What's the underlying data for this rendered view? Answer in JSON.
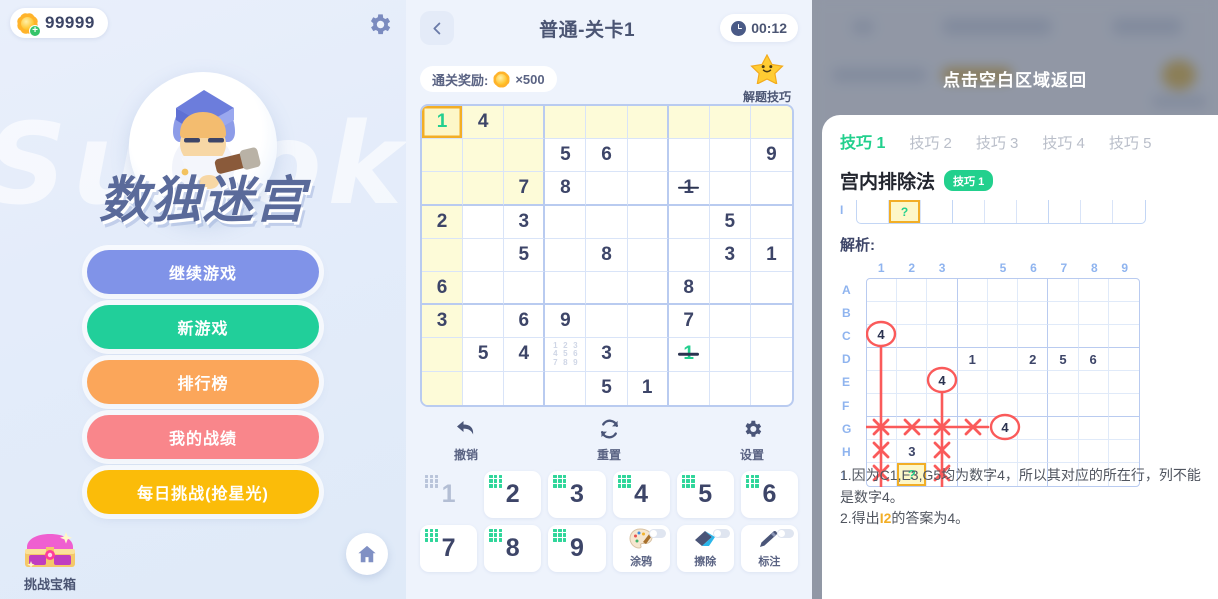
{
  "home": {
    "coin_count": "99999",
    "watermark": "Sudoku",
    "title": "数独迷宫",
    "gear_icon": "gear-icon",
    "coin_icon": "sun-coin-icon",
    "buttons": [
      {
        "label": "继续游戏",
        "color": "#8093e8"
      },
      {
        "label": "新游戏",
        "color": "#21cf9a"
      },
      {
        "label": "排行榜",
        "color": "#fba65a"
      },
      {
        "label": "我的战绩",
        "color": "#f9868b"
      },
      {
        "label": "每日挑战(抢星光)",
        "color": "#fbbc09"
      }
    ],
    "chest_label": "挑战宝箱",
    "home_icon": "home-icon"
  },
  "game": {
    "back_icon": "chevron-left-icon",
    "title": "普通-关卡1",
    "timer": "00:12",
    "clock_icon": "clock-icon",
    "reward_label": "通关奖励:",
    "reward_amount": "×500",
    "tips_label": "解题技巧",
    "star_icon": "star-icon",
    "grid": [
      [
        {
          "v": "1",
          "s": "user sel"
        },
        {
          "v": "4",
          "s": "hl"
        },
        {
          "v": "",
          "s": "hl"
        },
        {
          "v": "",
          "s": "hl"
        },
        {
          "v": "",
          "s": "hl"
        },
        {
          "v": "",
          "s": "hl"
        },
        {
          "v": "",
          "s": "hl"
        },
        {
          "v": "",
          "s": "hl"
        },
        {
          "v": "",
          "s": "hl"
        }
      ],
      [
        {
          "v": "",
          "s": "hl"
        },
        {
          "v": "",
          "s": "hl"
        },
        {
          "v": "",
          "s": "hl"
        },
        {
          "v": "5",
          "s": ""
        },
        {
          "v": "6",
          "s": ""
        },
        {
          "v": "",
          "s": ""
        },
        {
          "v": "",
          "s": ""
        },
        {
          "v": "",
          "s": ""
        },
        {
          "v": "9",
          "s": ""
        }
      ],
      [
        {
          "v": "",
          "s": "hl"
        },
        {
          "v": "",
          "s": "hl"
        },
        {
          "v": "7",
          "s": "hl"
        },
        {
          "v": "8",
          "s": ""
        },
        {
          "v": "",
          "s": ""
        },
        {
          "v": "",
          "s": ""
        },
        {
          "v": "1",
          "s": "strike"
        },
        {
          "v": "",
          "s": ""
        },
        {
          "v": "",
          "s": ""
        }
      ],
      [
        {
          "v": "2",
          "s": "hl"
        },
        {
          "v": "",
          "s": ""
        },
        {
          "v": "3",
          "s": ""
        },
        {
          "v": "",
          "s": ""
        },
        {
          "v": "",
          "s": ""
        },
        {
          "v": "",
          "s": ""
        },
        {
          "v": "",
          "s": ""
        },
        {
          "v": "5",
          "s": ""
        },
        {
          "v": "",
          "s": ""
        }
      ],
      [
        {
          "v": "",
          "s": "hl"
        },
        {
          "v": "",
          "s": ""
        },
        {
          "v": "5",
          "s": ""
        },
        {
          "v": "",
          "s": ""
        },
        {
          "v": "8",
          "s": ""
        },
        {
          "v": "",
          "s": ""
        },
        {
          "v": "",
          "s": ""
        },
        {
          "v": "3",
          "s": ""
        },
        {
          "v": "1",
          "s": ""
        }
      ],
      [
        {
          "v": "6",
          "s": "hl"
        },
        {
          "v": "",
          "s": ""
        },
        {
          "v": "",
          "s": ""
        },
        {
          "v": "",
          "s": ""
        },
        {
          "v": "",
          "s": ""
        },
        {
          "v": "",
          "s": ""
        },
        {
          "v": "8",
          "s": ""
        },
        {
          "v": "",
          "s": ""
        },
        {
          "v": "",
          "s": ""
        }
      ],
      [
        {
          "v": "3",
          "s": "hl"
        },
        {
          "v": "",
          "s": ""
        },
        {
          "v": "6",
          "s": ""
        },
        {
          "v": "9",
          "s": ""
        },
        {
          "v": "",
          "s": ""
        },
        {
          "v": "",
          "s": ""
        },
        {
          "v": "7",
          "s": ""
        },
        {
          "v": "",
          "s": ""
        },
        {
          "v": "",
          "s": ""
        }
      ],
      [
        {
          "v": "",
          "s": "hl"
        },
        {
          "v": "5",
          "s": ""
        },
        {
          "v": "4",
          "s": ""
        },
        {
          "v": "",
          "s": "notes"
        },
        {
          "v": "3",
          "s": ""
        },
        {
          "v": "",
          "s": ""
        },
        {
          "v": "1",
          "s": "user strike"
        },
        {
          "v": "",
          "s": ""
        },
        {
          "v": "",
          "s": ""
        }
      ],
      [
        {
          "v": "",
          "s": "hl"
        },
        {
          "v": "",
          "s": ""
        },
        {
          "v": "",
          "s": ""
        },
        {
          "v": "",
          "s": ""
        },
        {
          "v": "5",
          "s": ""
        },
        {
          "v": "1",
          "s": ""
        },
        {
          "v": "",
          "s": ""
        },
        {
          "v": "",
          "s": ""
        },
        {
          "v": "",
          "s": ""
        }
      ]
    ],
    "note_digits": [
      "1",
      "2",
      "3",
      "4",
      "5",
      "6",
      "7",
      "8",
      "9"
    ],
    "actions": [
      {
        "label": "撤销",
        "icon": "undo-arrow-icon"
      },
      {
        "label": "重置",
        "icon": "refresh-icon"
      },
      {
        "label": "设置",
        "icon": "gear-icon"
      }
    ],
    "numpad": [
      {
        "label": "1",
        "used": true
      },
      {
        "label": "2",
        "used": false
      },
      {
        "label": "3",
        "used": false
      },
      {
        "label": "4",
        "used": false
      },
      {
        "label": "5",
        "used": false
      },
      {
        "label": "6",
        "used": false
      },
      {
        "label": "7",
        "used": false
      },
      {
        "label": "8",
        "used": false
      },
      {
        "label": "9",
        "used": false
      }
    ],
    "tools": [
      {
        "label": "涂鸦",
        "icon": "palette-icon"
      },
      {
        "label": "擦除",
        "icon": "eraser-icon"
      },
      {
        "label": "标注",
        "icon": "pen-icon"
      }
    ]
  },
  "tips": {
    "dismiss_hint": "点击空白区域返回",
    "tabs": [
      {
        "label": "技巧 1",
        "active": true
      },
      {
        "label": "技巧 2",
        "active": false
      },
      {
        "label": "技巧 3",
        "active": false
      },
      {
        "label": "技巧 4",
        "active": false
      },
      {
        "label": "技巧 5",
        "active": false
      }
    ],
    "heading": "宫内排除法",
    "heading_badge": "技巧 1",
    "strip_row_label": "I",
    "strip_q": "?",
    "analysis_label": "解析:",
    "example": {
      "col_headers": [
        "1",
        "2",
        "3",
        "",
        "5",
        "6",
        "7",
        "8",
        "9"
      ],
      "row_headers": [
        "A",
        "B",
        "C",
        "D",
        "E",
        "F",
        "G",
        "H",
        "I"
      ],
      "values": [
        [
          "",
          "",
          "",
          "",
          "",
          "",
          "",
          "",
          ""
        ],
        [
          "",
          "",
          "",
          "",
          "",
          "",
          "",
          "",
          ""
        ],
        [
          "",
          "",
          "",
          "",
          "",
          "",
          "",
          "",
          ""
        ],
        [
          "",
          "",
          "",
          "1",
          "",
          "2",
          "5",
          "6",
          ""
        ],
        [
          "",
          "",
          "",
          "",
          "",
          "",
          "",
          "",
          ""
        ],
        [
          "",
          "",
          "",
          "",
          "",
          "",
          "",
          "",
          ""
        ],
        [
          "",
          "",
          "",
          "",
          "",
          "",
          "",
          "",
          ""
        ],
        [
          "",
          "3",
          "",
          "",
          "",
          "",
          "",
          "",
          ""
        ],
        [
          "",
          "?",
          "",
          "",
          "",
          "",
          "",
          "",
          ""
        ]
      ],
      "circled": [
        {
          "row": "C",
          "col": 1,
          "value": "4"
        },
        {
          "row": "E",
          "col": 3,
          "value": "4"
        },
        {
          "row": "G",
          "col": 5,
          "value": "4"
        }
      ],
      "marker_color": "#fa5a5a"
    },
    "notes": [
      {
        "pre": "1.因为C1,E3,G5均为数字4，所以其对应的所在行，列不能是数字4。",
        "hi": "",
        "post": ""
      },
      {
        "pre": "2.得出",
        "hi": "I2",
        "post": "的答案为4。"
      }
    ]
  }
}
